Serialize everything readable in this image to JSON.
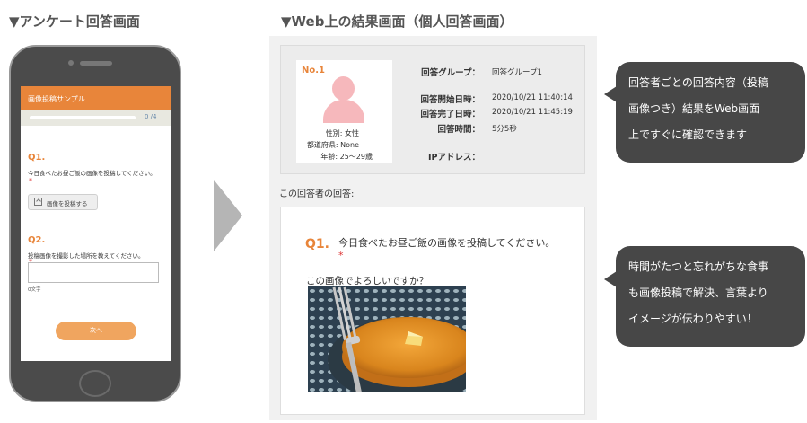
{
  "left_title": "▼アンケート回答画面",
  "right_title": "▼Web上の結果画面（個人回答画面）",
  "phone": {
    "header": "画像投稿サンプル",
    "progress": 0,
    "progress_text": "0 /4",
    "q1_num": "Q1.",
    "q1_text": "今日食べたお昼ご飯の画像を投稿してください。",
    "required_mark": "*",
    "upload_label": "画像を投稿する",
    "q2_num": "Q2.",
    "q2_text": "投稿画像を撮影した場所を教えてください。",
    "textarea_value": "",
    "char_count": "0文字",
    "next_label": "次へ"
  },
  "result": {
    "profile": {
      "no": "No.1",
      "gender": "性別: 女性",
      "prefecture": "都道府県: None",
      "age": "年齢: 25～29歳"
    },
    "info": [
      {
        "label": "回答グループ：",
        "value": "回答グループ1"
      },
      {
        "label": "回答開始日時：",
        "value": "2020/10/21 11:40:14"
      },
      {
        "label": "回答完了日時：",
        "value": "2020/10/21 11:45:19"
      },
      {
        "label": "回答時間：",
        "value": "5分5秒"
      },
      {
        "label": "IPアドレス：",
        "value": ""
      }
    ],
    "answers_title": "この回答者の回答:",
    "answer": {
      "q_num": "Q1.",
      "q_text": "今日食べたお昼ご飯の画像を投稿してください。",
      "required_mark": "*",
      "confirm_text": "この画像でよろしいですか？"
    }
  },
  "bubbles": {
    "top": [
      "回答者ごとの回答内容（投稿",
      "画像つき）結果をWeb画面",
      "上ですぐに確認できます"
    ],
    "bottom": [
      "時間がたつと忘れがちな食事",
      "も画像投稿で解決、言葉より",
      "イメージが伝わりやすい！"
    ]
  },
  "colors": {
    "accent": "#e8853a",
    "bubble": "#474747",
    "avatar": "#f6b8bc"
  },
  "icons": {
    "upload": "upload-icon",
    "avatar": "user-avatar-icon",
    "arrow": "right-arrow-icon"
  }
}
